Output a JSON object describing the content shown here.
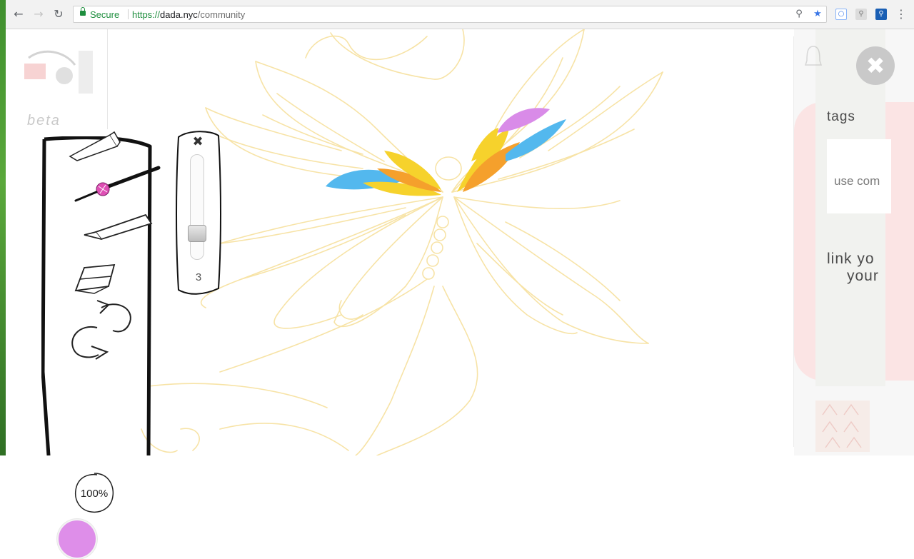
{
  "browser": {
    "secure_label": "Secure",
    "url_scheme": "https://",
    "url_host": "dada.nyc",
    "url_path": "/community",
    "icons": {
      "back": "back-arrow-icon",
      "forward": "forward-arrow-icon",
      "reload": "reload-icon",
      "zoom": "magnifier-icon",
      "bookmark": "star-icon",
      "menu": "kebab-menu-icon"
    },
    "colors": {
      "secure": "#1e8e3e",
      "bookmark_star": "#3b78e7"
    }
  },
  "header": {
    "beta_label": "beta"
  },
  "toolbar": {
    "tools": [
      "pencil",
      "brush",
      "marker",
      "eraser",
      "redo",
      "undo"
    ],
    "zoom_label": "100%",
    "current_color": "#de8ee9"
  },
  "brush_size": {
    "close_glyph": "✖",
    "value_label": "3",
    "level": 0.2
  },
  "side_panel": {
    "tags_label": "tags",
    "tags_placeholder": "use com",
    "link_line1": "link yo",
    "link_line2": "your",
    "close_glyph": "✖"
  },
  "drawing": {
    "stroke_color": "#f7e3a6",
    "fill_colors": [
      "#53b8ee",
      "#f6d22c",
      "#f5a02c",
      "#d98be8"
    ]
  }
}
